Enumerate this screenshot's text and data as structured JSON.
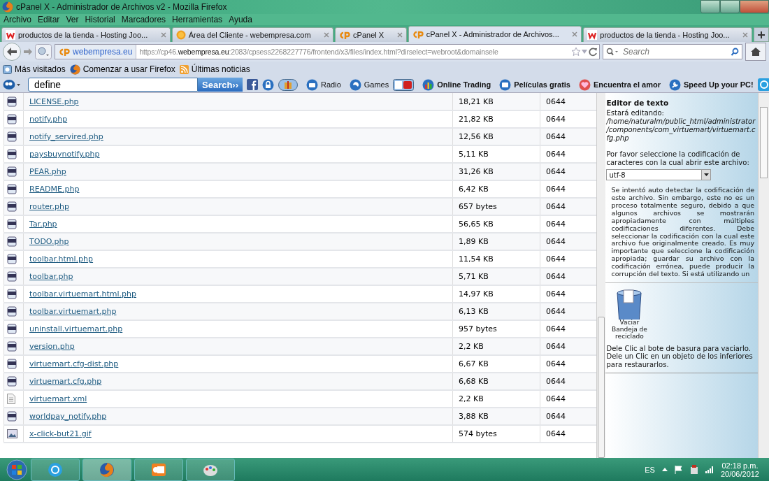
{
  "window": {
    "title": "cPanel X - Administrador de Archivos v2 - Mozilla Firefox"
  },
  "menu": [
    "Archivo",
    "Editar",
    "Ver",
    "Historial",
    "Marcadores",
    "Herramientas",
    "Ayuda"
  ],
  "tabs": [
    {
      "label": "productos de la tienda - Hosting Joo...",
      "selected": false,
      "kind": "brand"
    },
    {
      "label": "Área del Cliente - webempresa.com",
      "selected": false,
      "kind": "coin"
    },
    {
      "label": "cPanel X",
      "selected": false,
      "kind": "cpanel"
    },
    {
      "label": "cPanel X - Administrador de Archivos...",
      "selected": true,
      "kind": "cpanel"
    },
    {
      "label": "productos de la tienda - Hosting Joo...",
      "selected": false,
      "kind": "brand"
    }
  ],
  "nav": {
    "site": "webempresa.eu",
    "url_prefix": "https://cp46.",
    "url_host": "webempresa.eu",
    "url_rest": ":2083/cpsess2268227776/frontend/x3/files/index.html?dirselect=webroot&domainsele",
    "search_placeholder": "Search"
  },
  "bookmarks": [
    "Más visitados",
    "Comenzar a usar Firefox",
    "Últimas noticias"
  ],
  "toolbar": {
    "query": "define",
    "search_button": "Search››",
    "items": [
      {
        "label": "Radio",
        "kind": "radio"
      },
      {
        "label": "Games",
        "kind": "games"
      },
      {
        "label": "Online Trading",
        "kind": "chart"
      },
      {
        "label": "Películas gratis",
        "kind": "tv"
      },
      {
        "label": "Encuentra el amor",
        "kind": "heart"
      },
      {
        "label": "Speed Up your PC!",
        "kind": "wrench"
      }
    ]
  },
  "files": [
    {
      "name": "LICENSE.php",
      "size": "18,21 KB",
      "perms": "0644",
      "kind": "php"
    },
    {
      "name": "notify.php",
      "size": "21,82 KB",
      "perms": "0644",
      "kind": "php"
    },
    {
      "name": "notify_servired.php",
      "size": "12,56 KB",
      "perms": "0644",
      "kind": "php"
    },
    {
      "name": "paysbuynotify.php",
      "size": "5,11 KB",
      "perms": "0644",
      "kind": "php"
    },
    {
      "name": "PEAR.php",
      "size": "31,26 KB",
      "perms": "0644",
      "kind": "php"
    },
    {
      "name": "README.php",
      "size": "6,42 KB",
      "perms": "0644",
      "kind": "php"
    },
    {
      "name": "router.php",
      "size": "657 bytes",
      "perms": "0644",
      "kind": "php"
    },
    {
      "name": "Tar.php",
      "size": "56,65 KB",
      "perms": "0644",
      "kind": "php"
    },
    {
      "name": "TODO.php",
      "size": "1,89 KB",
      "perms": "0644",
      "kind": "php"
    },
    {
      "name": "toolbar.html.php",
      "size": "11,54 KB",
      "perms": "0644",
      "kind": "php"
    },
    {
      "name": "toolbar.php",
      "size": "5,71 KB",
      "perms": "0644",
      "kind": "php"
    },
    {
      "name": "toolbar.virtuemart.html.php",
      "size": "14,97 KB",
      "perms": "0644",
      "kind": "php"
    },
    {
      "name": "toolbar.virtuemart.php",
      "size": "6,13 KB",
      "perms": "0644",
      "kind": "php"
    },
    {
      "name": "uninstall.virtuemart.php",
      "size": "957 bytes",
      "perms": "0644",
      "kind": "php"
    },
    {
      "name": "version.php",
      "size": "2,2 KB",
      "perms": "0644",
      "kind": "php"
    },
    {
      "name": "virtuemart.cfg-dist.php",
      "size": "6,67 KB",
      "perms": "0644",
      "kind": "php"
    },
    {
      "name": "virtuemart.cfg.php",
      "size": "6,68 KB",
      "perms": "0644",
      "kind": "php"
    },
    {
      "name": "virtuemart.xml",
      "size": "2,2 KB",
      "perms": "0644",
      "kind": "xml"
    },
    {
      "name": "worldpay_notify.php",
      "size": "3,88 KB",
      "perms": "0644",
      "kind": "php"
    },
    {
      "name": "x-click-but21.gif",
      "size": "574 bytes",
      "perms": "0644",
      "kind": "gif"
    }
  ],
  "panel": {
    "title": "Editor de texto",
    "editing": "Estará editando: */home/naturalm/public_html/administrator/components/com_virtuemart/virtuemart.cfg.php*",
    "encoding_prompt": "Por favor seleccione la codificación de caracteres con la cual abrir este archivo:",
    "encoding": "utf-8",
    "warning": "Se intentó auto detectar la codificación de este archivo. Sin embargo, este no es un proceso totalmente seguro, debido a que algunos archivos se mostrarán apropiadamente con múltiples codificaciones diferentes. Debe seleccionar la codificación con la cual este archivo fue originalmente creado. Es muy importante que seleccione la codificación apropiada; guardar su archivo con la codificación errónea, puede producir la corrupción del texto. Si está utilizando un",
    "trash_label": "Vaciar Bandeja de reciclado",
    "trash_help": "Dele Clic al bote de basura para vaciarlo. Dele un Clic en un objeto de los inferiores para restaurarlos."
  },
  "taskbar": {
    "apps": [
      {
        "kind": "chat",
        "selected": false
      },
      {
        "kind": "browser",
        "selected": true
      },
      {
        "kind": "mail",
        "selected": false
      },
      {
        "kind": "paint",
        "selected": false
      }
    ],
    "language": "ES",
    "time": "02:18 p.m.",
    "date": "20/06/2012"
  }
}
